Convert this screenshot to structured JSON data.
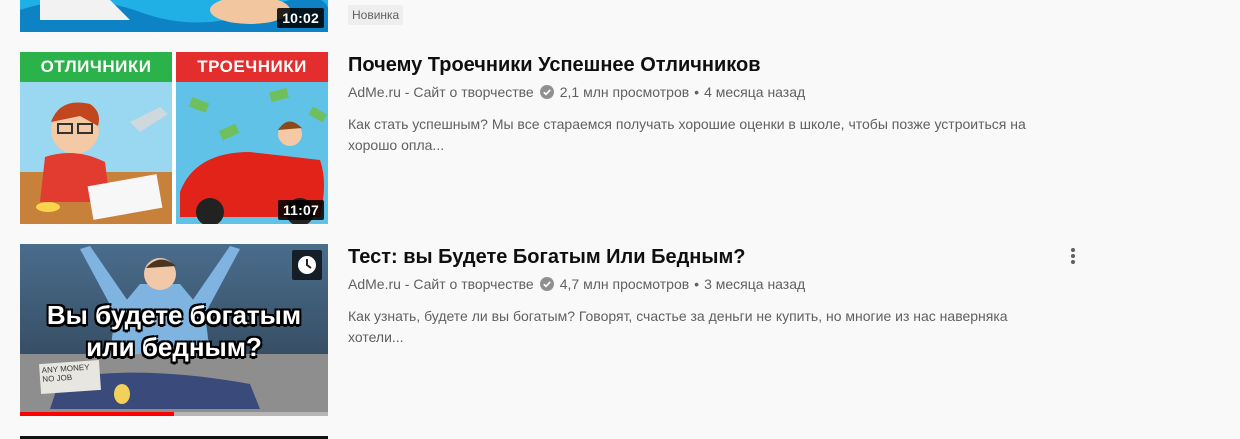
{
  "top_item": {
    "duration": "10:02",
    "badge": "Новинка"
  },
  "videos": [
    {
      "title": "Почему Троечники Успешнее Отличников",
      "channel": "AdMe.ru - Сайт о творчестве",
      "views": "2,1 млн просмотров",
      "separator": "•",
      "age": "4 месяца назад",
      "description": "Как стать успешным? Мы все стараемся получать хорошие оценки в школе, чтобы позже устроиться на хорошо опла...",
      "duration": "11:07",
      "thumb_left_label": "ОТЛИЧНИКИ",
      "thumb_right_label": "ТРОЕЧНИКИ"
    },
    {
      "title": "Тест: вы Будете Богатым Или Бедным?",
      "channel": "AdMe.ru - Сайт о творчестве",
      "views": "4,7 млн просмотров",
      "separator": "•",
      "age": "3 месяца назад",
      "description": "Как узнать, будете ли вы богатым? Говорят, счастье за деньги не купить, но многие из нас наверняка хотели...",
      "thumb_overlay_line1": "Вы будете богатым",
      "thumb_overlay_line2": "или бедным?",
      "sign_text": "ANY MONEY NO JOB",
      "watch_progress": 0.5
    }
  ],
  "colors": {
    "title": "#0f0f0f",
    "secondary": "#606060",
    "progress": "#ff0000",
    "background": "#f9f9f9"
  },
  "icons": [
    "verified-check-icon",
    "watch-later-clock-icon",
    "more-actions-icon"
  ]
}
